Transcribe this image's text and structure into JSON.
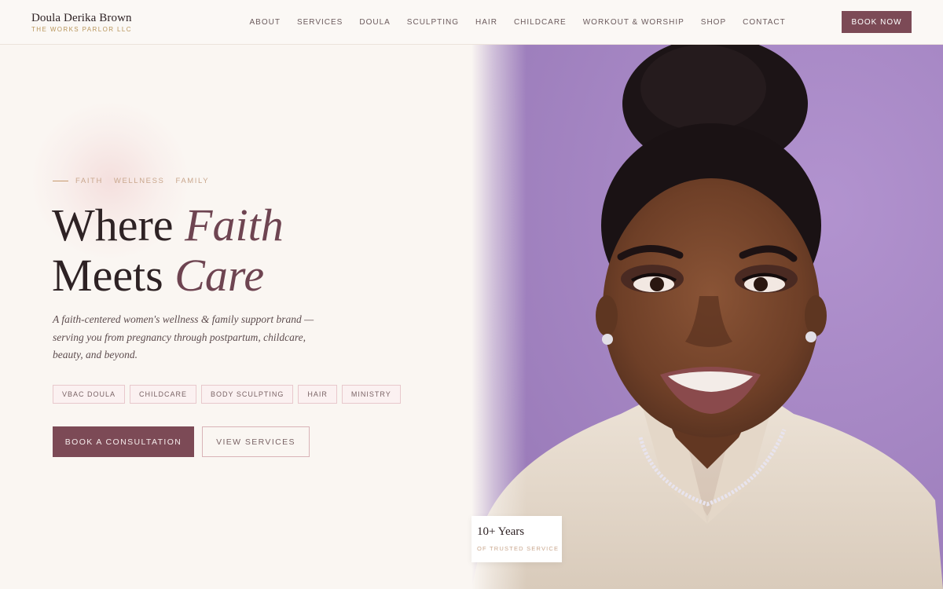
{
  "brand": {
    "name": "Doula Derika Brown",
    "subtitle": "THE WORKS PARLOR LLC"
  },
  "nav": {
    "items": [
      {
        "label": "ABOUT"
      },
      {
        "label": "SERVICES"
      },
      {
        "label": "DOULA"
      },
      {
        "label": "SCULPTING"
      },
      {
        "label": "HAIR"
      },
      {
        "label": "CHILDCARE"
      },
      {
        "label": "WORKOUT & WORSHIP"
      },
      {
        "label": "SHOP"
      },
      {
        "label": "CONTACT"
      }
    ],
    "cta_label": "BOOK NOW"
  },
  "hero": {
    "eyebrow": [
      "FAITH",
      "WELLNESS",
      "FAMILY"
    ],
    "headline_line1_plain": "Where ",
    "headline_line1_accent": "Faith",
    "headline_line2_plain": "Meets ",
    "headline_line2_accent": "Care",
    "description": "A faith-centered women's wellness & family support brand — serving you from pregnancy through postpartum, childcare, beauty, and beyond.",
    "tags": [
      "VBAC DOULA",
      "CHILDCARE",
      "BODY SCULPTING",
      "HAIR",
      "MINISTRY"
    ],
    "primary_cta": "BOOK A CONSULTATION",
    "secondary_cta": "VIEW SERVICES"
  },
  "stat": {
    "value": "10+ Years",
    "label": "OF TRUSTED SERVICE"
  },
  "colors": {
    "accent": "#7c4a56",
    "gold": "#b8955a",
    "background": "#faf6f2",
    "photo_backdrop": "#a988c6"
  }
}
